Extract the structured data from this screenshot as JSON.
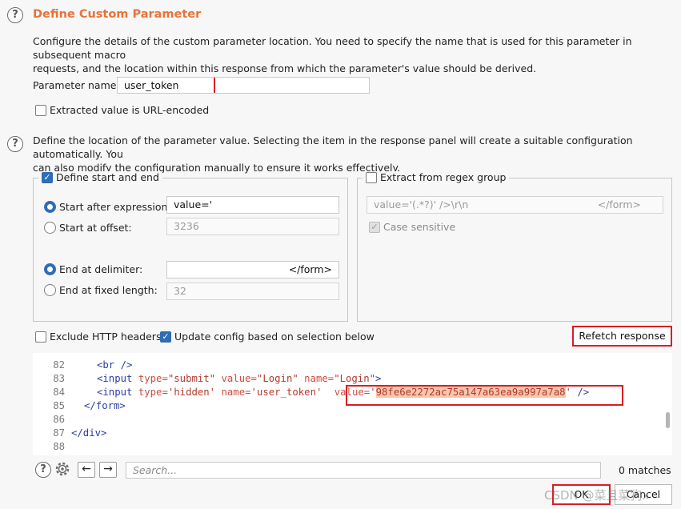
{
  "section1": {
    "title": "Define Custom Parameter",
    "desc_line1": "Configure the details of the custom parameter location. You need to specify the name that is used for this parameter in subsequent macro",
    "desc_line2": "requests, and the location within this response from which the parameter's value should be derived.",
    "param_label": "Parameter name:",
    "param_value": "user_token",
    "url_encoded_label": "Extracted value is URL-encoded"
  },
  "section2": {
    "desc_line1": "Define the location of the parameter value. Selecting the item in the response panel will create a suitable configuration automatically. You",
    "desc_line2": "can also modify the configuration manually to ensure it works effectively."
  },
  "start_end": {
    "legend": "Define start and end",
    "start_after_label": "Start after expression:",
    "start_after_value": "value='",
    "start_offset_label": "Start at offset:",
    "start_offset_value": "3236",
    "end_delim_label": "End at delimiter:",
    "end_delim_value": "</form>",
    "end_fixed_label": "End at fixed length:",
    "end_fixed_value": "32"
  },
  "regex": {
    "legend": "Extract from regex group",
    "regex_value": "value='(.*?)' />\\r\\n",
    "regex_end": "</form>",
    "case_label": "Case sensitive"
  },
  "options": {
    "exclude_headers": "Exclude HTTP headers",
    "update_config": "Update config based on selection below",
    "refetch": "Refetch response"
  },
  "code": {
    "lines": [
      {
        "n": "82"
      },
      {
        "n": "83"
      },
      {
        "n": "84"
      },
      {
        "n": "85"
      },
      {
        "n": "86"
      },
      {
        "n": "87"
      },
      {
        "n": "88"
      }
    ],
    "br": "<br />",
    "l83_open": "<input",
    "l83_a1": "type=",
    "l83_v1": "\"submit\"",
    "l83_a2": "value=",
    "l83_v2": "\"Login\"",
    "l83_a3": "name=",
    "l83_v3": "\"Login\"",
    "l83_close": ">",
    "l84_open": "<input",
    "l84_a1": "type=",
    "l84_v1": "'hidden'",
    "l84_a2": "name=",
    "l84_v2": "'user_token'",
    "l84_a3": "value=",
    "l84_q": "'",
    "l84_token": "98fe6e2272ac75a147a63ea9a997a7a8",
    "l84_q2": "'",
    "l84_close": " />",
    "l85": "</form>",
    "l87": "</div>"
  },
  "search": {
    "placeholder": "Search...",
    "matches": "0 matches"
  },
  "footer": {
    "ok": "OK",
    "cancel": "Cancel",
    "watermark": "CSDN @菜且菜狗x"
  }
}
